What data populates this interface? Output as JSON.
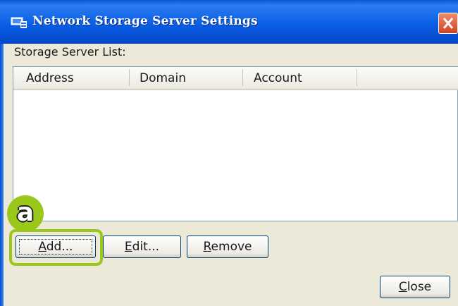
{
  "window": {
    "title": "Network Storage Server Settings",
    "app_icon": "network-storage-app-icon",
    "close_icon": "close-x-icon",
    "accent_color": "#0a5fe6",
    "close_color": "#d2431d"
  },
  "list": {
    "label": "Storage Server List:",
    "columns": [
      "Address",
      "Domain",
      "Account"
    ],
    "rows": []
  },
  "buttons": {
    "add": {
      "prefix": "",
      "accel": "A",
      "suffix": "dd..."
    },
    "edit": {
      "prefix": "",
      "accel": "E",
      "suffix": "dit..."
    },
    "remove": {
      "prefix": "",
      "accel": "R",
      "suffix": "emove"
    },
    "close": {
      "prefix": "",
      "accel": "C",
      "suffix": "lose"
    }
  },
  "annotation": {
    "marker": "a",
    "highlight_color": "#9ac81a"
  }
}
